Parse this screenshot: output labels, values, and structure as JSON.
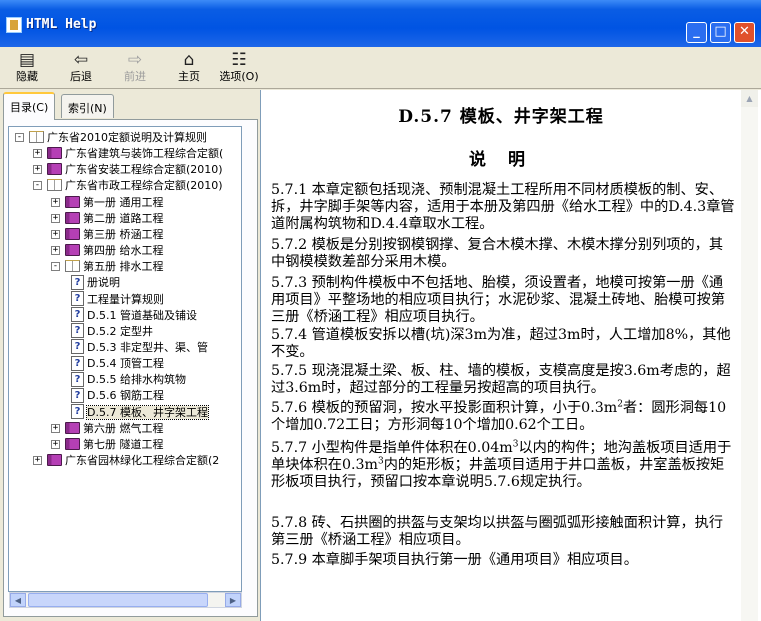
{
  "window": {
    "title": "HTML Help",
    "controls": {
      "minimize": "_",
      "maximize": "□",
      "close": "✕"
    }
  },
  "toolbar": {
    "items": [
      {
        "label": "隐藏",
        "icon": "hide-icon",
        "glyph": "▤",
        "disabled": false
      },
      {
        "label": "后退",
        "icon": "back-arrow-icon",
        "glyph": "⇦",
        "disabled": false
      },
      {
        "label": "前进",
        "icon": "forward-arrow-icon",
        "glyph": "⇨",
        "disabled": true
      },
      {
        "label": "主页",
        "icon": "home-icon",
        "glyph": "⌂",
        "disabled": false
      },
      {
        "label": "选项(O)",
        "icon": "options-icon",
        "glyph": "☷",
        "disabled": false
      }
    ]
  },
  "tabs": [
    {
      "label": "目录(C)",
      "active": true
    },
    {
      "label": "索引(N)",
      "active": false
    }
  ],
  "tree": [
    {
      "level": 0,
      "type": "open",
      "expander": "-",
      "label": "广东省2010定额说明及计算规则",
      "selected": false
    },
    {
      "level": 1,
      "type": "closed",
      "expander": "+",
      "label": "广东省建筑与装饰工程综合定额(",
      "selected": false
    },
    {
      "level": 1,
      "type": "closed",
      "expander": "+",
      "label": "广东省安装工程综合定额(2010)",
      "selected": false
    },
    {
      "level": 1,
      "type": "open",
      "expander": "-",
      "label": "广东省市政工程综合定额(2010)",
      "selected": false
    },
    {
      "level": 2,
      "type": "closed",
      "expander": "+",
      "label": "第一册 通用工程",
      "selected": false
    },
    {
      "level": 2,
      "type": "closed",
      "expander": "+",
      "label": "第二册 道路工程",
      "selected": false
    },
    {
      "level": 2,
      "type": "closed",
      "expander": "+",
      "label": "第三册 桥涵工程",
      "selected": false
    },
    {
      "level": 2,
      "type": "closed",
      "expander": "+",
      "label": "第四册 给水工程",
      "selected": false
    },
    {
      "level": 2,
      "type": "open",
      "expander": "-",
      "label": "第五册 排水工程",
      "selected": false
    },
    {
      "level": 3,
      "type": "page",
      "expander": "",
      "label": "册说明",
      "selected": false
    },
    {
      "level": 3,
      "type": "page",
      "expander": "",
      "label": "工程量计算规则",
      "selected": false
    },
    {
      "level": 3,
      "type": "page",
      "expander": "",
      "label": "D.5.1  管道基础及铺设",
      "selected": false
    },
    {
      "level": 3,
      "type": "page",
      "expander": "",
      "label": "D.5.2  定型井",
      "selected": false
    },
    {
      "level": 3,
      "type": "page",
      "expander": "",
      "label": "D.5.3  非定型井、渠、管",
      "selected": false
    },
    {
      "level": 3,
      "type": "page",
      "expander": "",
      "label": "D.5.4  顶管工程",
      "selected": false
    },
    {
      "level": 3,
      "type": "page",
      "expander": "",
      "label": "D.5.5  给排水构筑物",
      "selected": false
    },
    {
      "level": 3,
      "type": "page",
      "expander": "",
      "label": "D.5.6  钢筋工程",
      "selected": false
    },
    {
      "level": 3,
      "type": "page",
      "expander": "",
      "label": "D.5.7  模板、井字架工程",
      "selected": true
    },
    {
      "level": 2,
      "type": "closed",
      "expander": "+",
      "label": "第六册 燃气工程",
      "selected": false
    },
    {
      "level": 2,
      "type": "closed",
      "expander": "+",
      "label": "第七册 隧道工程",
      "selected": false
    },
    {
      "level": 1,
      "type": "closed",
      "expander": "+",
      "label": "广东省园林绿化工程综合定额(2",
      "selected": false
    }
  ],
  "content": {
    "title": "D.5.7  模板、井字架工程",
    "subtitle": "说 明",
    "paragraphs": [
      {
        "html": "5.7.1  本章定额包括现浇、预制混凝土工程所用不同材质模板的制、安、拆，井字脚手架等内容，适用于本册及第四册《给水工程》中的D.4.3章管道附属构筑物和D.4.4章取水工程。"
      },
      {
        "html": "5.7.2  模板是分别按钢模钢撑、复合木模木撑、木模木撑分别列项的，其中钢模模数差部分采用木模。"
      },
      {
        "html": "5.7.3  预制构件模板中不包括地、胎模，须设置者，地模可按第一册《通用项目》平整场地的相应项目执行；水泥砂浆、混凝土砖地、胎模可按第三册《桥涵工程》相应项目执行。"
      },
      {
        "html": "5.7.4  管道模板安拆以槽(坑)深3m为准，超过3m时，人工增加8%，其他不变。"
      },
      {
        "html": "5.7.5  现浇混凝土梁、板、柱、墙的模板，支模高度是按3.6m考虑的，超过3.6m时，超过部分的工程量另按超高的项目执行。"
      },
      {
        "html": "5.7.6  模板的预留洞，按水平投影面积计算，小于0.3m<sup>2</sup>者：圆形洞每10个增加0.72工日；方形洞每10个增加0.62个工日。"
      },
      {
        "html": "5.7.7  小型构件是指单件体积在0.04m<sup>3</sup>以内的构件；地沟盖板项目适用于单块体积在0.3m<sup>3</sup>内的矩形板；井盖项目适用于井口盖板，井室盖板按矩形板项目执行，预留口按本章说明5.7.6规定执行。"
      },
      {
        "html": "5.7.8  砖、石拱圈的拱盔与支架均以拱盔与圈弧弧形接触面积计算，执行第三册《桥涵工程》相应项目。"
      },
      {
        "html": "5.7.9  本章脚手架项目执行第一册《通用项目》相应项目。"
      }
    ]
  }
}
